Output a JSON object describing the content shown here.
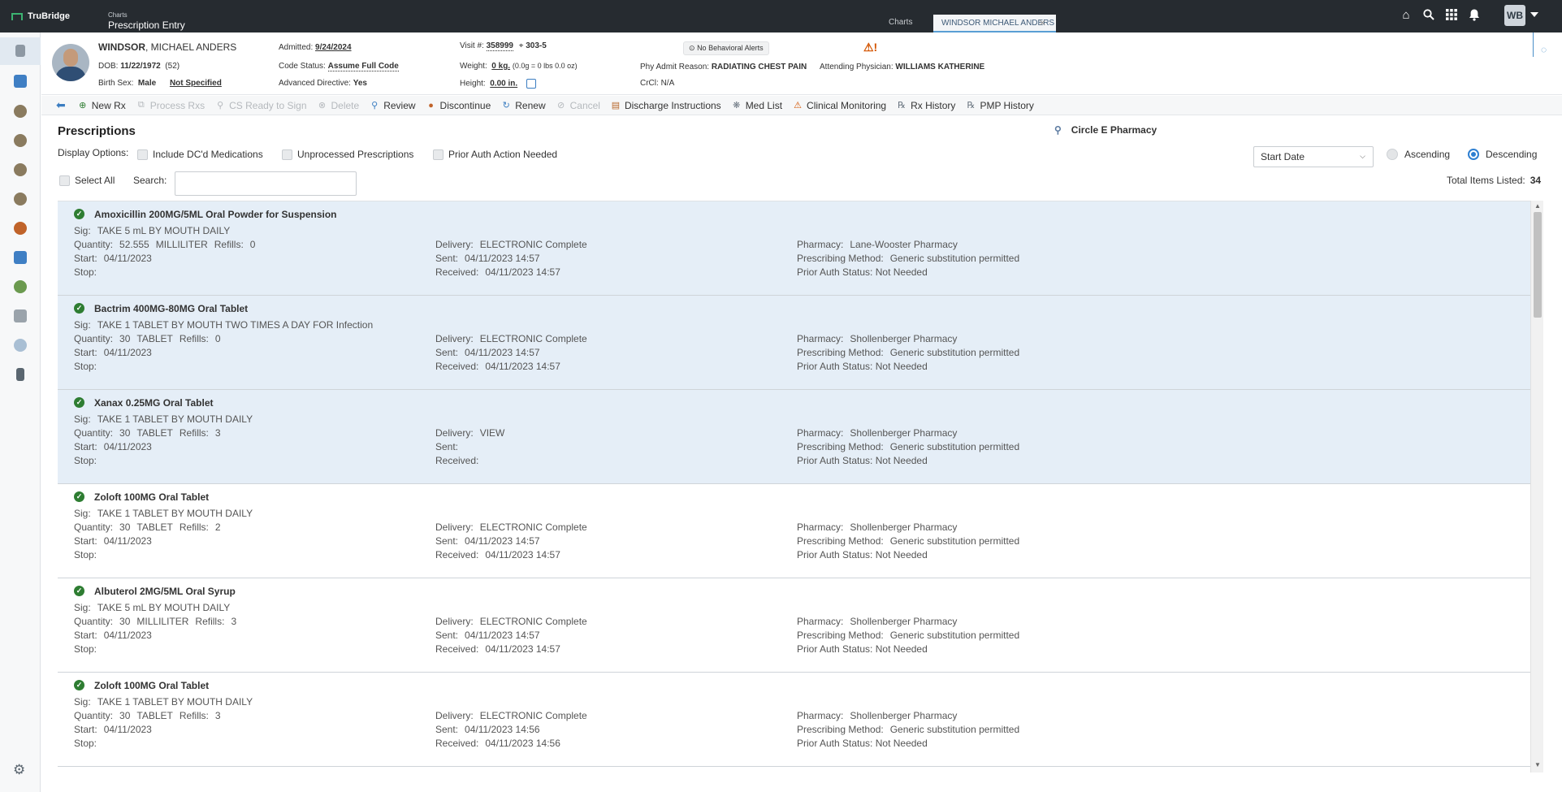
{
  "app": {
    "brand": "TruBridge",
    "crumb_parent": "Charts",
    "crumb_current": "Prescription Entry",
    "tabs": [
      {
        "label": "Charts"
      },
      {
        "label": "WINDSOR MICHAEL ANDERS"
      }
    ],
    "user_initials": "WB"
  },
  "patient": {
    "last_name": "WINDSOR",
    "first_name": ", MICHAEL ANDERS",
    "dob_label": "DOB:",
    "dob": "11/22/1972",
    "age": "(52)",
    "birth_sex_label": "Birth Sex:",
    "birth_sex": "Male",
    "gender_identity": "Not Specified",
    "admitted_label": "Admitted:",
    "admitted": "9/24/2024",
    "code_status_label": "Code Status:",
    "code_status": "Assume Full Code",
    "adv_directive_label": "Advanced Directive:",
    "adv_directive": "Yes",
    "visit_label": "Visit #:",
    "visit": "358999",
    "room": "303-5",
    "weight_label": "Weight:",
    "weight": "0 kg.",
    "weight_detail": "(0.0g = 0 lbs 0.0 oz)",
    "height_label": "Height:",
    "height": "0.00 in.",
    "behavioral_alert": "No Behavioral Alerts",
    "admit_reason_label": "Phy Admit Reason:",
    "admit_reason": "RADIATING CHEST PAIN",
    "crcl_label": "CrCl:",
    "crcl": "N/A",
    "attending_label": "Attending Physician:",
    "attending": "WILLIAMS KATHERINE"
  },
  "toolbar": {
    "items": [
      {
        "label": "New Rx",
        "enabled": true,
        "icon": "plus-circle-icon"
      },
      {
        "label": "Process Rxs",
        "enabled": false,
        "icon": "rx-process-icon"
      },
      {
        "label": "CS Ready to Sign",
        "enabled": false,
        "icon": "magnify-icon"
      },
      {
        "label": "Delete",
        "enabled": false,
        "icon": "delete-icon"
      },
      {
        "label": "Review",
        "enabled": true,
        "icon": "magnify-icon"
      },
      {
        "label": "Discontinue",
        "enabled": true,
        "icon": "discontinue-icon"
      },
      {
        "label": "Renew",
        "enabled": true,
        "icon": "renew-icon"
      },
      {
        "label": "Cancel",
        "enabled": false,
        "icon": "cancel-icon"
      },
      {
        "label": "Discharge Instructions",
        "enabled": true,
        "icon": "discharge-icon"
      },
      {
        "label": "Med List",
        "enabled": true,
        "icon": "med-list-icon"
      },
      {
        "label": "Clinical Monitoring",
        "enabled": true,
        "icon": "warning-icon"
      },
      {
        "label": "Rx History",
        "enabled": true,
        "icon": "rx-history-icon"
      },
      {
        "label": "PMP History",
        "enabled": true,
        "icon": "pmp-history-icon"
      }
    ]
  },
  "main": {
    "title": "Prescriptions",
    "pharmacy": "Circle E Pharmacy",
    "display_options_label": "Display Options:",
    "options": [
      "Include DC'd Medications",
      "Unprocessed Prescriptions",
      "Prior Auth Action Needed"
    ],
    "sort_by": "Start Date",
    "ascending_label": "Ascending",
    "descending_label": "Descending",
    "select_all_label": "Select All",
    "search_label": "Search:",
    "search_value": "",
    "total_label": "Total Items Listed:",
    "total": "34"
  },
  "labels": {
    "sig": "Sig:",
    "quantity": "Quantity:",
    "refills": "Refills:",
    "start": "Start:",
    "stop": "Stop:",
    "delivery": "Delivery:",
    "sent": "Sent:",
    "received": "Received:",
    "pharmacy": "Pharmacy:",
    "method": "Prescribing Method:",
    "prior_auth": "Prior Auth Status:"
  },
  "prescriptions": [
    {
      "drug": "Amoxicillin 200MG/5ML Oral Powder for Suspension",
      "sig": "TAKE 5 mL BY MOUTH DAILY",
      "qty": "52.555",
      "unit": "MILLILITER",
      "refills": "0",
      "start": "04/11/2023",
      "stop": "",
      "delivery": "ELECTRONIC Complete",
      "sent": "04/11/2023 14:57",
      "received": "04/11/2023 14:57",
      "pharmacy": "Lane-Wooster Pharmacy",
      "method": "Generic substitution permitted",
      "prior_auth": "Not Needed"
    },
    {
      "drug": "Bactrim 400MG-80MG Oral Tablet",
      "sig": "TAKE 1 TABLET BY MOUTH TWO TIMES A DAY FOR Infection",
      "qty": "30",
      "unit": "TABLET",
      "refills": "0",
      "start": "04/11/2023",
      "stop": "",
      "delivery": "ELECTRONIC Complete",
      "sent": "04/11/2023 14:57",
      "received": "04/11/2023 14:57",
      "pharmacy": "Shollenberger Pharmacy",
      "method": "Generic substitution permitted",
      "prior_auth": "Not Needed"
    },
    {
      "drug": "Xanax 0.25MG Oral Tablet",
      "sig": "TAKE 1 TABLET BY MOUTH DAILY",
      "qty": "30",
      "unit": "TABLET",
      "refills": "3",
      "start": "04/11/2023",
      "stop": "",
      "delivery": "VIEW",
      "sent": "",
      "received": "",
      "pharmacy": "Shollenberger Pharmacy",
      "method": "Generic substitution permitted",
      "prior_auth": "Not Needed"
    },
    {
      "drug": "Zoloft 100MG Oral Tablet",
      "sig": "TAKE 1 TABLET BY MOUTH DAILY",
      "qty": "30",
      "unit": "TABLET",
      "refills": "2",
      "start": "04/11/2023",
      "stop": "",
      "delivery": "ELECTRONIC Complete",
      "sent": "04/11/2023 14:57",
      "received": "04/11/2023 14:57",
      "pharmacy": "Shollenberger Pharmacy",
      "method": "Generic substitution permitted",
      "prior_auth": "Not Needed"
    },
    {
      "drug": "Albuterol 2MG/5ML Oral Syrup",
      "sig": "TAKE 5 mL BY MOUTH DAILY",
      "qty": "30",
      "unit": "MILLILITER",
      "refills": "3",
      "start": "04/11/2023",
      "stop": "",
      "delivery": "ELECTRONIC Complete",
      "sent": "04/11/2023 14:57",
      "received": "04/11/2023 14:57",
      "pharmacy": "Shollenberger Pharmacy",
      "method": "Generic substitution permitted",
      "prior_auth": "Not Needed"
    },
    {
      "drug": "Zoloft 100MG Oral Tablet",
      "sig": "TAKE 1 TABLET BY MOUTH DAILY",
      "qty": "30",
      "unit": "TABLET",
      "refills": "3",
      "start": "04/11/2023",
      "stop": "",
      "delivery": "ELECTRONIC Complete",
      "sent": "04/11/2023 14:56",
      "received": "04/11/2023 14:56",
      "pharmacy": "Shollenberger Pharmacy",
      "method": "Generic substitution permitted",
      "prior_auth": "Not Needed"
    }
  ],
  "partial_item": "Amoxicillin 200MG/5ML Oral Powder for Suspension",
  "colors": {
    "topbar": "#262b30",
    "selected_row": "#e5eef7",
    "accent": "#2e7fd1"
  }
}
